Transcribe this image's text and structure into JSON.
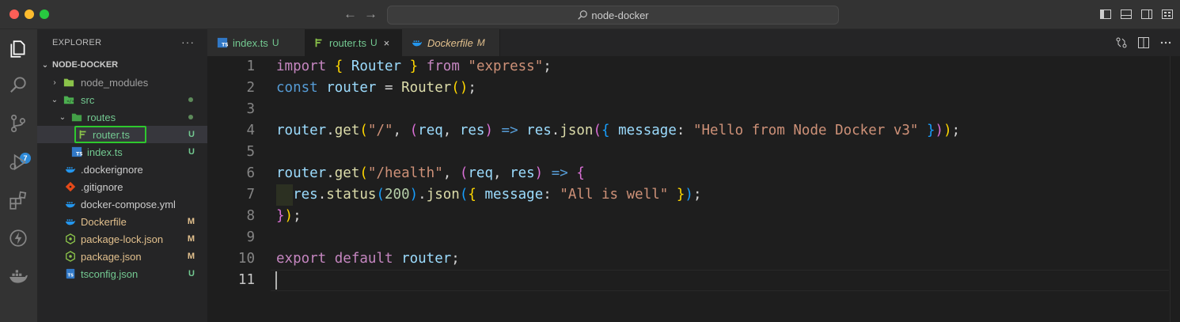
{
  "window": {
    "search_text": "node-docker",
    "nav_back": "←",
    "nav_forward": "→"
  },
  "colors": {
    "accent_badge": "#2e8ad8",
    "untracked": "#73c991",
    "modified": "#e2c08d",
    "focus_outline": "#2ec82e"
  },
  "activity_bar": {
    "items": [
      "explorer-icon",
      "search-icon",
      "source-control-icon",
      "run-debug-icon",
      "extensions-icon",
      "thunder-icon",
      "docker-icon"
    ],
    "source_control_badge": "7"
  },
  "explorer": {
    "header": "EXPLORER",
    "more": "···",
    "section": "NODE-DOCKER",
    "items": [
      {
        "label": "node_modules",
        "status": ""
      },
      {
        "label": "src",
        "status": ""
      },
      {
        "label": "routes",
        "status": ""
      },
      {
        "label": "router.ts",
        "status": "U"
      },
      {
        "label": "index.ts",
        "status": "U"
      },
      {
        "label": ".dockerignore",
        "status": ""
      },
      {
        "label": ".gitignore",
        "status": ""
      },
      {
        "label": "docker-compose.yml",
        "status": ""
      },
      {
        "label": "Dockerfile",
        "status": "M"
      },
      {
        "label": "package-lock.json",
        "status": "M"
      },
      {
        "label": "package.json",
        "status": "M"
      },
      {
        "label": "tsconfig.json",
        "status": "U"
      }
    ]
  },
  "tabs": [
    {
      "label": "index.ts",
      "status": "U",
      "active": false
    },
    {
      "label": "router.ts",
      "status": "U",
      "active": true,
      "close": "×"
    },
    {
      "label": "Dockerfile",
      "status": "M",
      "active": false
    }
  ],
  "editor": {
    "current_line": 11,
    "lines": [
      {
        "n": "1",
        "tokens": [
          [
            "kw",
            "import"
          ],
          [
            "op",
            " "
          ],
          [
            "b1",
            "{"
          ],
          [
            "op",
            " "
          ],
          [
            "var",
            "Router"
          ],
          [
            "op",
            " "
          ],
          [
            "b1",
            "}"
          ],
          [
            "op",
            " "
          ],
          [
            "kw",
            "from"
          ],
          [
            "op",
            " "
          ],
          [
            "str",
            "\"express\""
          ],
          [
            "op",
            ";"
          ]
        ]
      },
      {
        "n": "2",
        "tokens": [
          [
            "kw2",
            "const"
          ],
          [
            "op",
            " "
          ],
          [
            "var",
            "router"
          ],
          [
            "op",
            " = "
          ],
          [
            "fn",
            "Router"
          ],
          [
            "b1",
            "()"
          ],
          [
            "op",
            ";"
          ]
        ]
      },
      {
        "n": "3",
        "tokens": []
      },
      {
        "n": "4",
        "tokens": [
          [
            "var",
            "router"
          ],
          [
            "op",
            "."
          ],
          [
            "fn",
            "get"
          ],
          [
            "b1",
            "("
          ],
          [
            "str",
            "\"/\""
          ],
          [
            "op",
            ", "
          ],
          [
            "b2",
            "("
          ],
          [
            "var",
            "req"
          ],
          [
            "op",
            ", "
          ],
          [
            "var",
            "res"
          ],
          [
            "b2",
            ")"
          ],
          [
            "op",
            " "
          ],
          [
            "kw2",
            "=>"
          ],
          [
            "op",
            " "
          ],
          [
            "var",
            "res"
          ],
          [
            "op",
            "."
          ],
          [
            "fn",
            "json"
          ],
          [
            "b2",
            "("
          ],
          [
            "b3",
            "{"
          ],
          [
            "op",
            " "
          ],
          [
            "var",
            "message"
          ],
          [
            "op",
            ": "
          ],
          [
            "str",
            "\"Hello from Node Docker v3\""
          ],
          [
            "op",
            " "
          ],
          [
            "b3",
            "}"
          ],
          [
            "b2",
            ")"
          ],
          [
            "b1",
            ")"
          ],
          [
            "op",
            ";"
          ]
        ]
      },
      {
        "n": "5",
        "tokens": []
      },
      {
        "n": "6",
        "tokens": [
          [
            "var",
            "router"
          ],
          [
            "op",
            "."
          ],
          [
            "fn",
            "get"
          ],
          [
            "b1",
            "("
          ],
          [
            "str",
            "\"/health\""
          ],
          [
            "op",
            ", "
          ],
          [
            "b2",
            "("
          ],
          [
            "var",
            "req"
          ],
          [
            "op",
            ", "
          ],
          [
            "var",
            "res"
          ],
          [
            "b2",
            ")"
          ],
          [
            "op",
            " "
          ],
          [
            "kw2",
            "=>"
          ],
          [
            "op",
            " "
          ],
          [
            "b2",
            "{"
          ]
        ]
      },
      {
        "n": "7",
        "tokens": [
          [
            "op",
            "  "
          ],
          [
            "var",
            "res"
          ],
          [
            "op",
            "."
          ],
          [
            "fn",
            "status"
          ],
          [
            "b3",
            "("
          ],
          [
            "num",
            "200"
          ],
          [
            "b3",
            ")"
          ],
          [
            "op",
            "."
          ],
          [
            "fn",
            "json"
          ],
          [
            "b3",
            "("
          ],
          [
            "b1",
            "{"
          ],
          [
            "op",
            " "
          ],
          [
            "var",
            "message"
          ],
          [
            "op",
            ": "
          ],
          [
            "str",
            "\"All is well\""
          ],
          [
            "op",
            " "
          ],
          [
            "b1",
            "}"
          ],
          [
            "b3",
            ")"
          ],
          [
            "op",
            ";"
          ]
        ]
      },
      {
        "n": "8",
        "tokens": [
          [
            "b2",
            "}"
          ],
          [
            "b1",
            ")"
          ],
          [
            "op",
            ";"
          ]
        ]
      },
      {
        "n": "9",
        "tokens": []
      },
      {
        "n": "10",
        "tokens": [
          [
            "kw",
            "export"
          ],
          [
            "op",
            " "
          ],
          [
            "kw",
            "default"
          ],
          [
            "op",
            " "
          ],
          [
            "var",
            "router"
          ],
          [
            "op",
            ";"
          ]
        ]
      },
      {
        "n": "11",
        "tokens": []
      }
    ]
  }
}
